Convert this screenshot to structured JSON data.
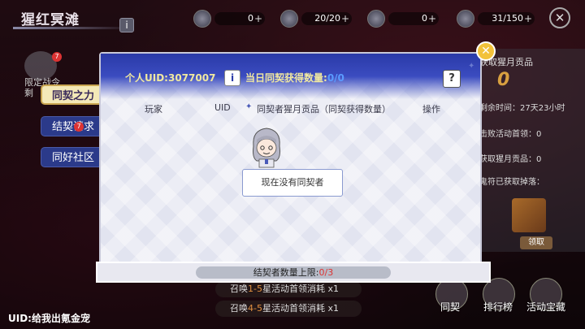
{
  "page": {
    "title": "猩红冥滩",
    "uid_display": "UID:给我出氪金宠"
  },
  "resources": [
    {
      "icon": "gear-crystal-icon",
      "value": "0"
    },
    {
      "icon": "green-orb-icon",
      "value": "20/20"
    },
    {
      "icon": "flower-icon",
      "value": "0"
    },
    {
      "icon": "staff-icon",
      "value": "31/150"
    }
  ],
  "left": {
    "event_label_1": "限定战令",
    "event_label_2": "剩",
    "badge": "7"
  },
  "tabs": [
    {
      "label": "同契之力",
      "active": true
    },
    {
      "label": "结契请求",
      "active": false,
      "badge": "7"
    },
    {
      "label": "同好社区",
      "active": false
    }
  ],
  "modal": {
    "uid_label": "个人UID:3077007",
    "daily_label": "当日同契获得数量:",
    "daily_value": "0/0",
    "columns": [
      "玩家",
      "UID",
      "同契者猩月贡品（同契获得数量）",
      "操作"
    ],
    "empty_text": "现在没有同契者",
    "footer_label": "结契者数量上限:",
    "footer_value": "0/3"
  },
  "right_panel": {
    "header": "获取猩月贡品",
    "big_number": "0",
    "timer": "剩余时间：27天23小时",
    "row1": "击败活动首领：0",
    "row2": "获取猩月贡品：0",
    "row3": "鬼符已获取掉落：",
    "claim": "领取"
  },
  "summons": [
    {
      "prefix": "召唤",
      "highlight": "1-5",
      "suffix": "星活动首领消耗",
      "qty": "x1"
    },
    {
      "prefix": "召唤",
      "highlight": "4-5",
      "suffix": "星活动首领消耗",
      "qty": "x1"
    }
  ],
  "bottom_nav": [
    "同契",
    "排行榜",
    "活动宝藏"
  ]
}
